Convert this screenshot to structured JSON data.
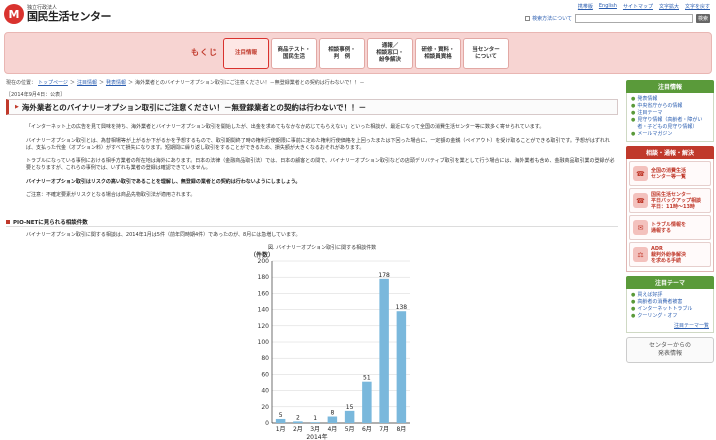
{
  "header": {
    "logo_mark": "M",
    "logo_sub": "独立行政法人",
    "logo_main": "国民生活センター",
    "utility_links": [
      "携帯版",
      "English",
      "サイトマップ",
      "文字拡大",
      "文字を戻す"
    ],
    "search_check_label": "検索方法について",
    "search_button": "検索"
  },
  "nav": {
    "label": "もくじ",
    "tabs": [
      {
        "label": "注目情報",
        "active": true
      },
      {
        "label": "商品テスト・\n国民生活",
        "active": false
      },
      {
        "label": "相談事例・\n判　例",
        "active": false
      },
      {
        "label": "通報／\n相談窓口・\n紛争解決",
        "active": false
      },
      {
        "label": "研修・資料・\n相談員資格",
        "active": false
      },
      {
        "label": "当センター\nについて",
        "active": false
      }
    ]
  },
  "breadcrumb": {
    "prefix": "現在の位置：",
    "items": [
      "トップページ",
      "注目情報",
      "発表情報"
    ],
    "current": "海外業者とのバイナリーオプション取引にご注意ください！－無登録業者との契約は行わないで！！－"
  },
  "dateline": "［2014年9月4日：公表］",
  "main": {
    "title": "海外業者とのバイナリーオプション取引にご注意ください！－無登録業者との契約は行わないで！！－",
    "paragraphs": [
      "「インターネット上の広告を見て興味を持ち、海外業者とバイナリーオプション取引を開始したが、出金を求めてもなかなか応じてもらえない」といった相談が、最近になって全国の消費生活センター等に数多く寄せられています。",
      "バイナリーオプション取引とは、為替相場等が上がるか下がるかを予想するもので、取引期間終了時の権利行使期限に事前に定めた権利行使価格を上回ったまたは下回った場合に、一定額の金銭（ペイアウト）を受け取ることができる取引です。予想がはずれれば、支払った代金（オプション料）がすべて損失になります。短期間に繰り返し取引をすることができるため、損失額が大きくなるおそれがあります。",
      "トラブルになっている事例における相手方業者の所在地は海外にあります。日本の法律（金融商品取引法）では、日本の顧客との間で、バイナリーオプション取引などの店頭デリバティブ取引を業として行う場合には、海外業者も含め、金融商品取引業の登録が必要となりますが、これらの事例では、いずれも業者の登録は確認できていません。",
      "ご注意：不確定要素がリスクとなる場合は商品先物取引法が適用されます。"
    ],
    "notice": "バイナリーオプション取引はリスクの高い取引であることを理解し、無登録の業者との契約は行わないようにしましょう。",
    "section_title": "PIO-NETに見られる相談件数",
    "section_text": "バイナリーオプション取引に関する相談は、2014年1月は5件（前年同時期4件）であったのが、8月には急増しています。",
    "chart_caption": "図. バイナリーオプション取引に関する相談件数"
  },
  "chart_data": {
    "type": "bar",
    "categories": [
      "1月",
      "2月",
      "3月",
      "4月",
      "5月",
      "6月",
      "7月",
      "8月"
    ],
    "values": [
      5,
      2,
      1,
      8,
      15,
      51,
      178,
      138
    ],
    "ylabel": "（件数）",
    "xlabel": "2014年",
    "ylim": [
      0,
      200
    ],
    "yticks": [
      0,
      20,
      40,
      60,
      80,
      100,
      120,
      140,
      160,
      180,
      200
    ],
    "bar_color": "#7ab8dc",
    "grid": true
  },
  "sidebar": {
    "notice_title": "注目情報",
    "notice_items": [
      "発表情報",
      "中央省庁からの情報",
      "注目テーマ",
      "見守り情報（高齢者・障がい者・子どもの見守り情報）",
      "メールマガジン"
    ],
    "contact_title": "相談・通報・解決",
    "contact_items": [
      {
        "icon": "☎",
        "label": "全国の消費生活\nセンター等一覧"
      },
      {
        "icon": "☎",
        "label": "国民生活センター\n平日バックアップ相談\n平日：11時～13時"
      },
      {
        "icon": "✉",
        "label": "トラブル情報を\n通報する"
      },
      {
        "icon": "⚖",
        "label": "ADR\n裁判外紛争解決\nを求める手続"
      }
    ],
    "theme_title": "注目テーマ",
    "theme_items": [
      "買えば好評",
      "高齢者の消費者被害",
      "インターネットトラブル",
      "クーリング・オフ"
    ],
    "theme_more": "注目テーマ一覧",
    "release_label": "センターからの\n発表情報"
  }
}
